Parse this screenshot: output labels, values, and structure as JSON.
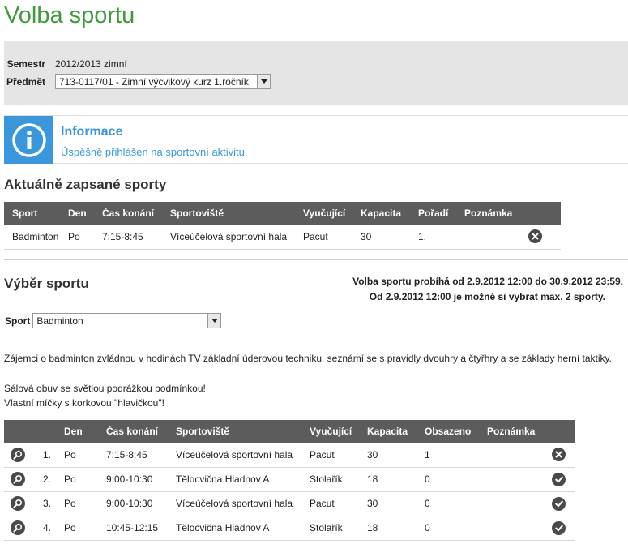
{
  "page_title": "Volba sportu",
  "filter": {
    "semester_label": "Semestr",
    "semester_value": "2012/2013 zimní",
    "subject_label": "Předmět",
    "subject_value": "713-0117/01 - Zimní výcvikový kurz 1.ročník"
  },
  "info": {
    "title": "Informace",
    "message": "Úspěšně přihlášen na sportovní aktivitu."
  },
  "enrolled": {
    "title": "Aktuálně zapsané sporty",
    "headers": [
      "Sport",
      "Den",
      "Čas konání",
      "Sportoviště",
      "Vyučující",
      "Kapacita",
      "Pořadí",
      "Poznámka"
    ],
    "rows": [
      {
        "sport": "Badminton",
        "day": "Po",
        "time": "7:15-8:45",
        "venue": "Víceúčelová sportovní hala",
        "teacher": "Pacut",
        "capacity": "30",
        "order": "1.",
        "note": ""
      }
    ]
  },
  "selection": {
    "title": "Výběr sportu",
    "period_line1": "Volba sportu probíhá od 2.9.2012 12:00 do 30.9.2012 23:59.",
    "period_line2": "Od 2.9.2012 12:00 je možné si vybrat max. 2 sporty.",
    "sport_label": "Sport",
    "sport_value": "Badminton",
    "description": "Zájemci o badminton zvládnou v hodinách TV základní úderovou techniku, seznámí se s pravidly dvouhry a čtyřhry a se základy herní taktiky.",
    "note1": "Sálová obuv se světlou podrážkou podmínkou!",
    "note2": "Vlastní míčky s korkovou \"hlavičkou\"!"
  },
  "courses": {
    "headers": [
      "",
      "Den",
      "Čas konání",
      "Sportoviště",
      "Vyučující",
      "Kapacita",
      "Obsazeno",
      "Poznámka"
    ],
    "rows": [
      {
        "num": "1.",
        "day": "Po",
        "time": "7:15-8:45",
        "venue": "Víceúčelová sportovní hala",
        "teacher": "Pacut",
        "capacity": "30",
        "occupied": "1",
        "action": "unenroll-icon"
      },
      {
        "num": "2.",
        "day": "Po",
        "time": "9:00-10:30",
        "venue": "Tělocvična Hladnov A",
        "teacher": "Stolařík",
        "capacity": "18",
        "occupied": "0",
        "action": "enroll-icon"
      },
      {
        "num": "3.",
        "day": "Po",
        "time": "9:00-10:30",
        "venue": "Víceúčelová sportovní hala",
        "teacher": "Pacut",
        "capacity": "30",
        "occupied": "0",
        "action": "enroll-icon"
      },
      {
        "num": "4.",
        "day": "Po",
        "time": "10:45-12:15",
        "venue": "Tělocvična Hladnov A",
        "teacher": "Stolařík",
        "capacity": "18",
        "occupied": "0",
        "action": "enroll-icon"
      }
    ]
  },
  "colors": {
    "title_green": "#3e9a3a",
    "info_blue": "#3a97dc",
    "header_gray": "#5c5c5c"
  }
}
